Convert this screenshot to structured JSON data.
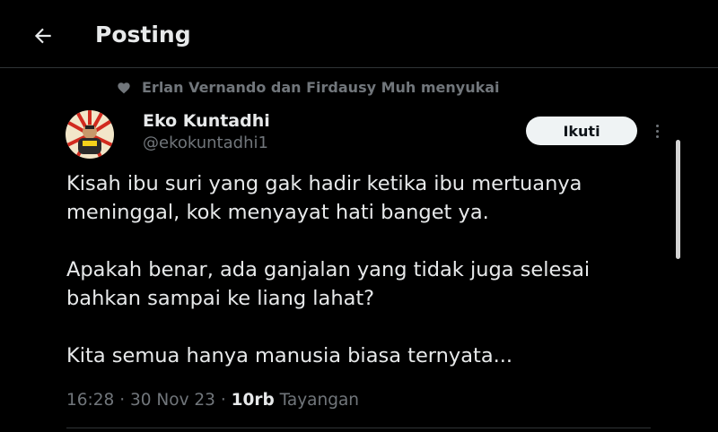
{
  "header": {
    "title": "Posting",
    "back_icon": "arrow-left-icon"
  },
  "social_context": {
    "icon": "heart-icon",
    "text": "Erlan Vernando dan Firdausy Muh menyukai"
  },
  "author": {
    "display_name": "Eko Kuntadhi",
    "handle": "@ekokuntadhi1"
  },
  "follow_button": {
    "label": "Ikuti"
  },
  "tweet": {
    "lines": [
      "Kisah ibu suri yang gak hadir ketika ibu mertuanya",
      "meninggal, kok menyayat hati banget ya.",
      "Apakah benar, ada ganjalan yang tidak juga selesai",
      "bahkan sampai ke liang lahat?",
      "Kita semua hanya manusia biasa ternyata..."
    ]
  },
  "meta": {
    "time": "16:28",
    "separator": "·",
    "date": "30 Nov 23",
    "views_count": "10rb",
    "views_label": "Tayangan"
  },
  "colors": {
    "background": "#000000",
    "text_primary": "#e7e9ea",
    "text_secondary": "#71767b",
    "border": "#2f3336",
    "follow_bg": "#eff3f4"
  }
}
